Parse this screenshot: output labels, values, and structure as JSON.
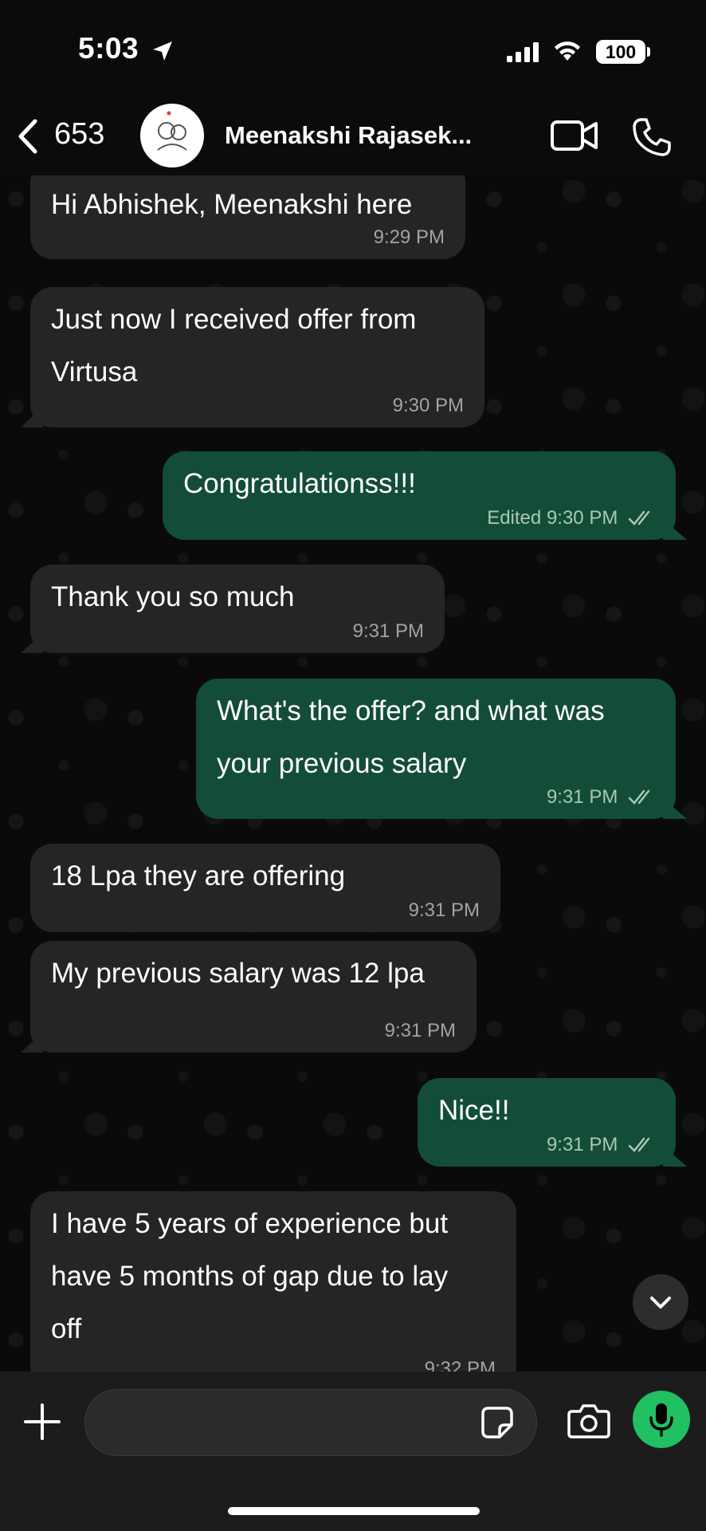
{
  "status_bar": {
    "time": "5:03",
    "battery": "100"
  },
  "header": {
    "unread_count": "653",
    "contact_name": "Meenakshi Rajasek..."
  },
  "messages": [
    {
      "direction": "in",
      "text": [
        "Hi Abhishek, Meenakshi here"
      ],
      "time": "9:29 PM"
    },
    {
      "direction": "in",
      "text": [
        "Just now I received offer from",
        "Virtusa"
      ],
      "time": "9:30 PM"
    },
    {
      "direction": "out",
      "text": [
        "Congratulationss!!!"
      ],
      "edited": "Edited",
      "time": "9:30 PM",
      "read": true
    },
    {
      "direction": "in",
      "text": [
        "Thank you so much"
      ],
      "time": "9:31 PM"
    },
    {
      "direction": "out",
      "text": [
        "What's the offer? and what was",
        "your previous salary"
      ],
      "time": "9:31 PM",
      "read": true
    },
    {
      "direction": "in",
      "text": [
        "18 Lpa they are offering"
      ],
      "time": "9:31 PM"
    },
    {
      "direction": "in",
      "text": [
        "My previous salary was 12 lpa"
      ],
      "time": "9:31 PM"
    },
    {
      "direction": "out",
      "text": [
        "Nice!!"
      ],
      "time": "9:31 PM",
      "read": true
    },
    {
      "direction": "in",
      "text": [
        "I have 5 years of experience but",
        "have 5 months of gap due to lay",
        "off"
      ],
      "time": "9:32 PM"
    }
  ],
  "composer": {
    "placeholder": "",
    "value": ""
  },
  "colors": {
    "incoming_bubble": "#252525",
    "outgoing_bubble": "#134d37",
    "accent_green": "#21c063",
    "read_ticks": "#a9c7b9"
  }
}
